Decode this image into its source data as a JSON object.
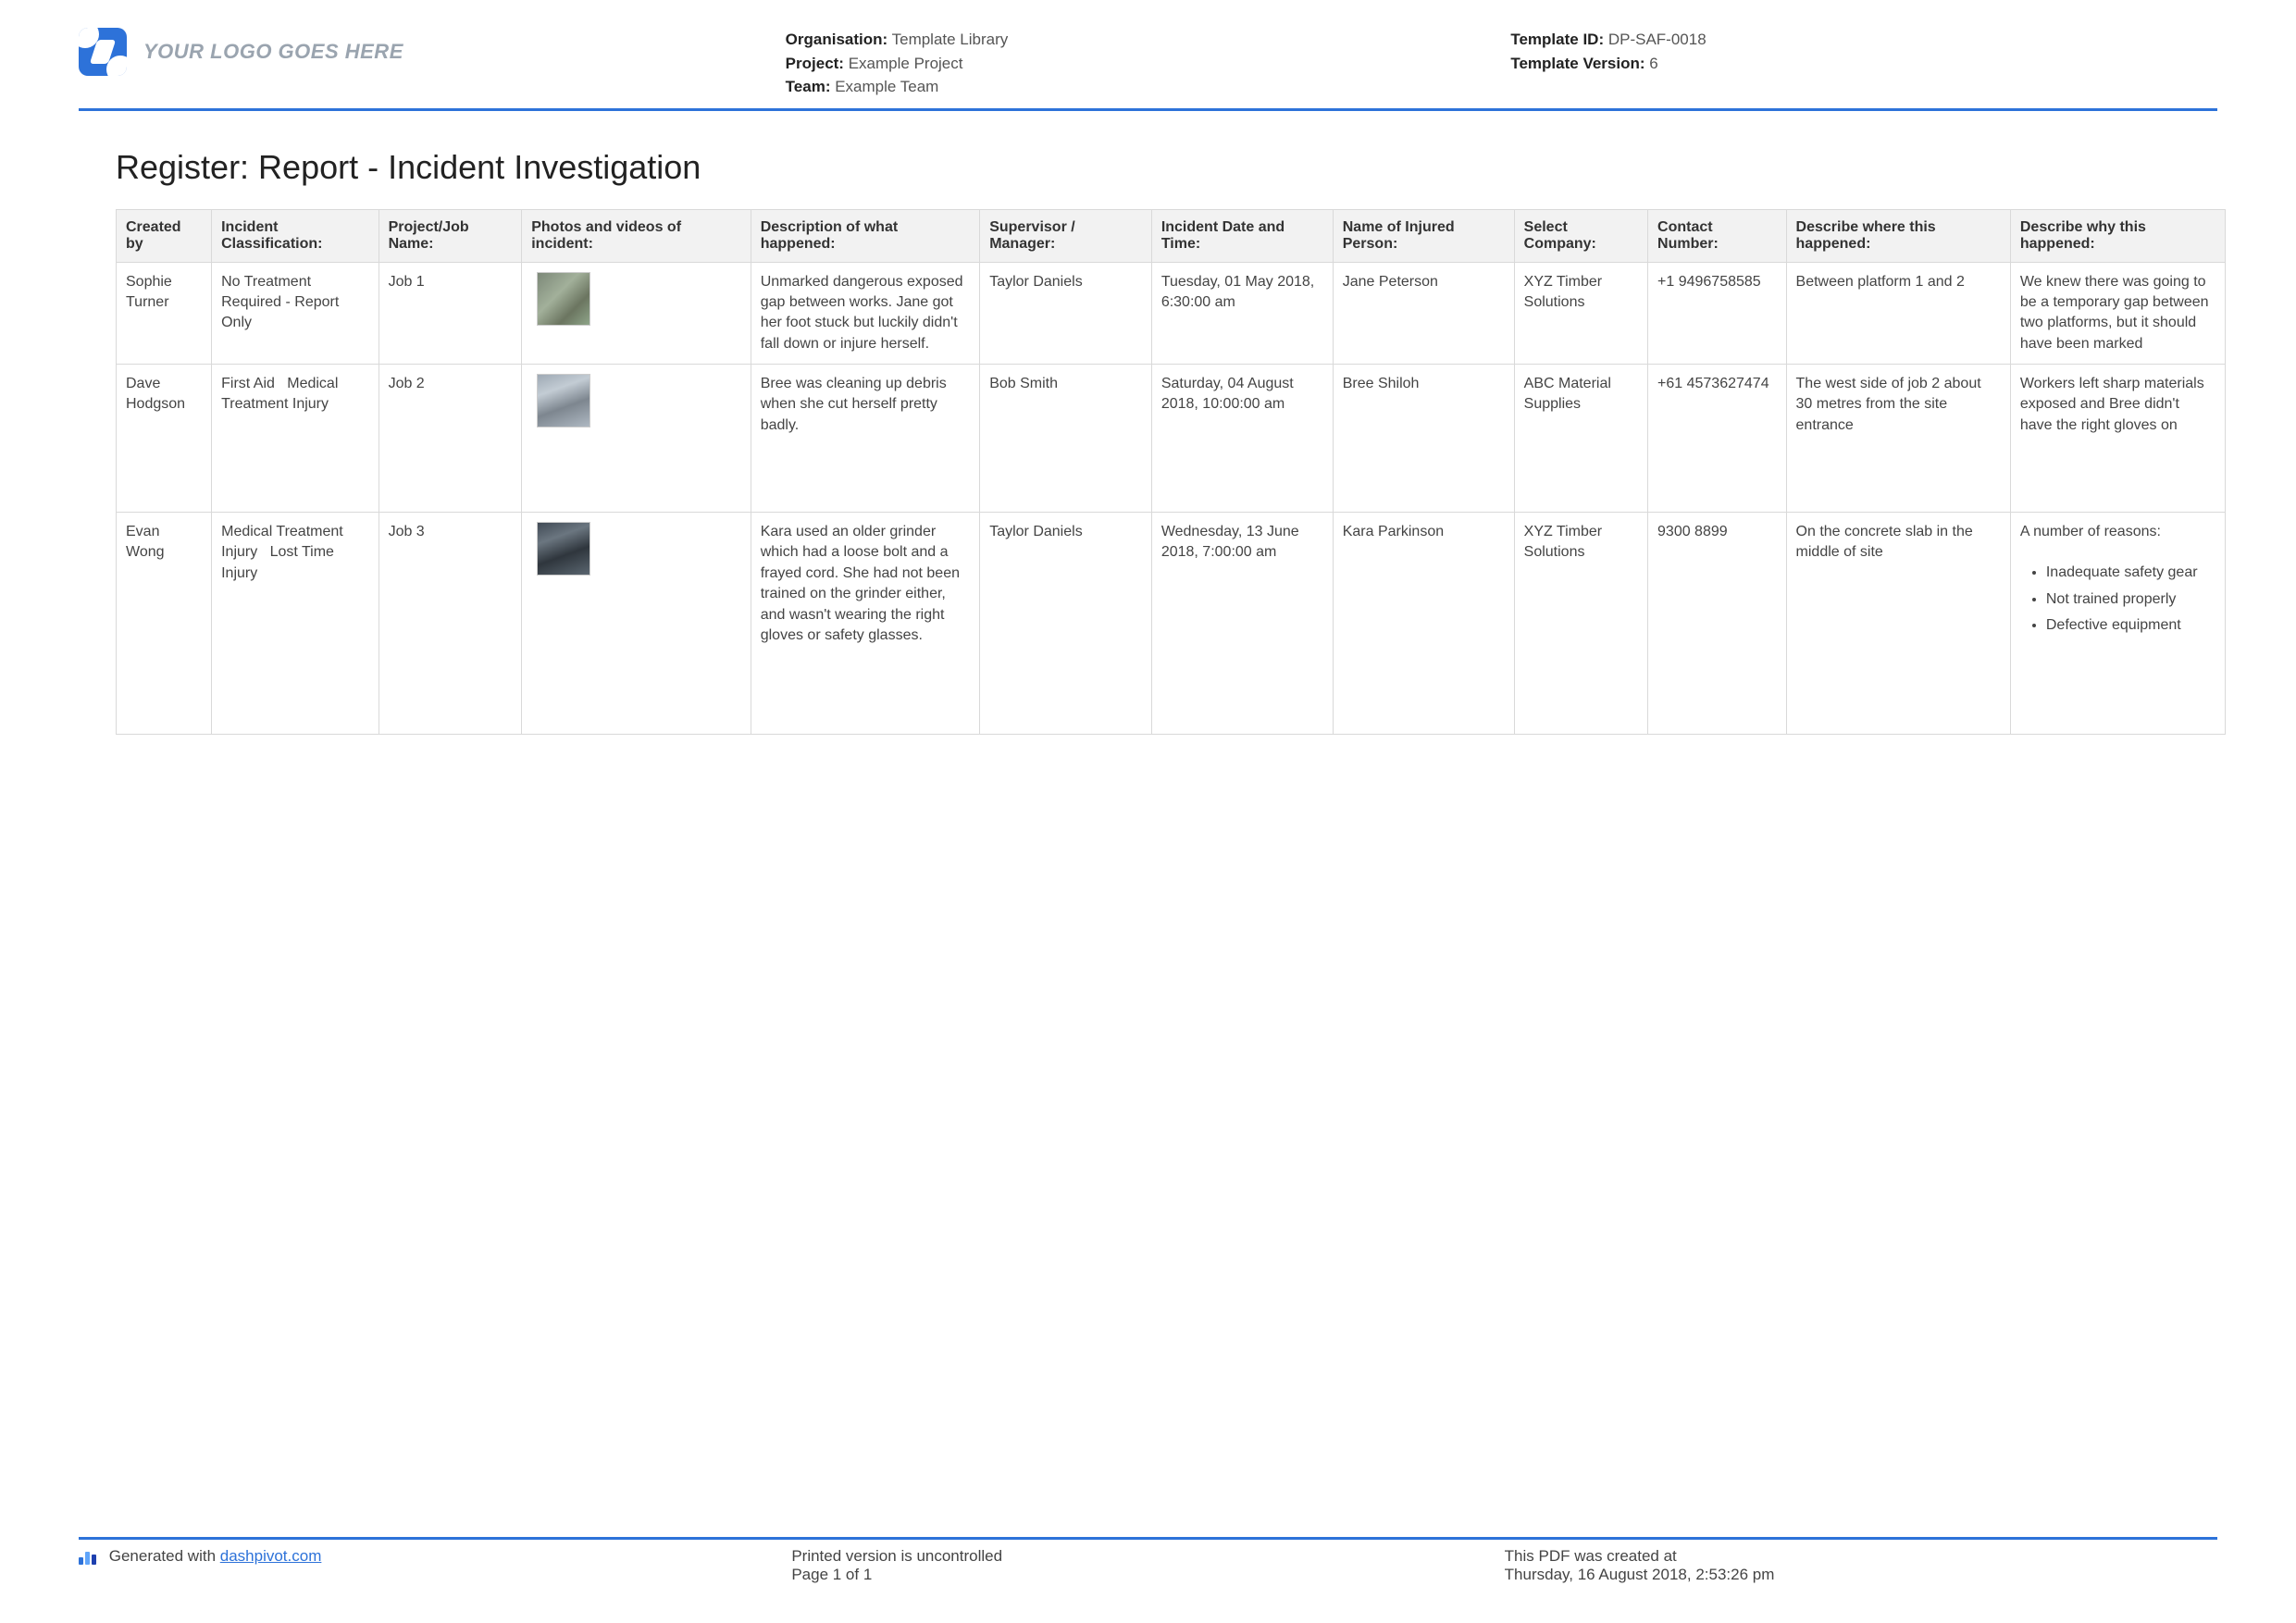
{
  "header": {
    "logo_placeholder": "YOUR LOGO GOES HERE",
    "organisation_label": "Organisation:",
    "organisation_value": "Template Library",
    "project_label": "Project:",
    "project_value": "Example Project",
    "team_label": "Team:",
    "team_value": "Example Team",
    "template_id_label": "Template ID:",
    "template_id_value": "DP-SAF-0018",
    "template_version_label": "Template Version:",
    "template_version_value": "6"
  },
  "title": "Register: Report - Incident Investigation",
  "columns": {
    "created_by": "Created by",
    "classification": "Incident Classification:",
    "job": "Project/Job Name:",
    "photos": "Photos and videos of incident:",
    "description": "Description of what happened:",
    "supervisor": "Supervisor / Manager:",
    "datetime": "Incident Date and Time:",
    "injured": "Name of Injured Person:",
    "company": "Select Company:",
    "contact": "Contact Number:",
    "where": "Describe where this happened:",
    "why": "Describe why this happened:"
  },
  "rows": [
    {
      "created_by": "Sophie Turner",
      "classification": "No Treatment Required - Report Only",
      "job": "Job 1",
      "description": "Unmarked dangerous exposed gap between works. Jane got her foot stuck but luckily didn't fall down or injure herself.",
      "supervisor": "Taylor Daniels",
      "datetime": "Tuesday, 01 May 2018, 6:30:00 am",
      "injured": "Jane Peterson",
      "company": "XYZ Timber Solutions",
      "contact": "+1 9496758585",
      "where": "Between platform 1 and 2",
      "why": "We knew there was going to be a temporary gap between two platforms, but it should have been marked"
    },
    {
      "created_by": "Dave Hodgson",
      "classification": "First Aid   Medical Treatment Injury",
      "job": "Job 2",
      "description": "Bree was cleaning up debris when she cut herself pretty badly.",
      "supervisor": "Bob Smith",
      "datetime": "Saturday, 04 August 2018, 10:00:00 am",
      "injured": "Bree Shiloh",
      "company": "ABC Material Supplies",
      "contact": "+61 4573627474",
      "where": "The west side of job 2 about 30 metres from the site entrance",
      "why": "Workers left sharp materials exposed and Bree didn't have the right gloves on"
    },
    {
      "created_by": "Evan Wong",
      "classification": "Medical Treatment Injury   Lost Time Injury",
      "job": "Job 3",
      "description": "Kara used an older grinder which had a loose bolt and a frayed cord. She had not been trained on the grinder either, and wasn't wearing the right gloves or safety glasses.",
      "supervisor": "Taylor Daniels",
      "datetime": "Wednesday, 13 June 2018, 7:00:00 am",
      "injured": "Kara Parkinson",
      "company": "XYZ Timber Solutions",
      "contact": "9300 8899",
      "where": "On the concrete slab in the middle of site",
      "why_intro": "A number of reasons:",
      "why_list": [
        "Inadequate safety gear",
        "Not trained properly",
        "Defective equipment"
      ]
    }
  ],
  "footer": {
    "generated_prefix": "Generated with ",
    "generated_link": "dashpivot.com",
    "uncontrolled": "Printed version is uncontrolled",
    "page": "Page 1 of 1",
    "created_label": "This PDF was created at",
    "created_value": "Thursday, 16 August 2018, 2:53:26 pm"
  }
}
